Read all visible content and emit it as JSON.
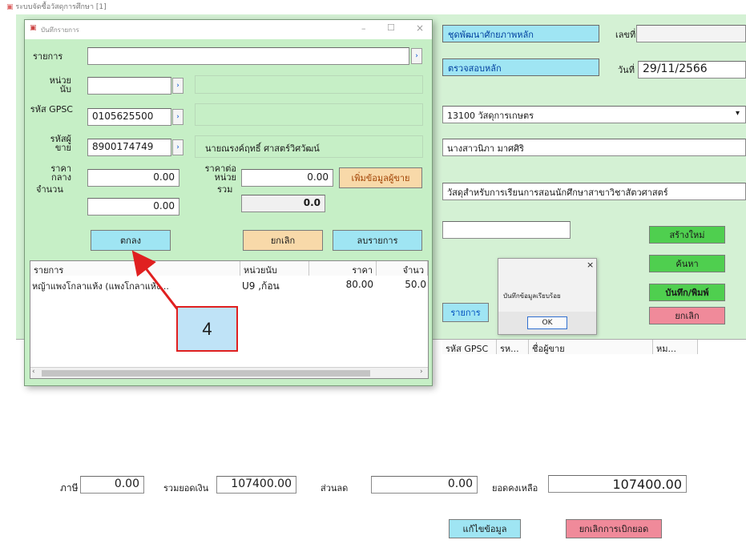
{
  "window": {
    "title": "ระบบจัดซื้อวัสดุการศึกษา [1]"
  },
  "main": {
    "top_box_1": "ชุดพัฒนาศักยภาพหลัก",
    "top_box_2": "ตรวจสอบหลัก",
    "doc_no_label": "เลขที่",
    "doc_no_value": "",
    "date_label": "วันที่",
    "date_value": "29/11/2566",
    "department_value": "13100 วัสดุการเกษตร",
    "person_value": "นางสาวนิภา มาศศิริ",
    "purpose_value": "วัสดุสำหรับการเรียนการสอนนักศึกษาสาขาวิชาสัตวศาสตร์",
    "remark_value": "",
    "btn_new": "สร้างใหม่",
    "btn_search": "ค้นหา",
    "btn_save_print": "บันทึก/พิมพ์",
    "btn_cancel": "ยกเลิก",
    "btn_items": "รายการ",
    "grid_headers": [
      "รหัส GPSC",
      "รห...",
      "ชื่อผู้ขาย",
      "หม..."
    ],
    "vat_label": "ภาษี",
    "vat_value": "0.00",
    "total_label": "รวมยอดเงิน",
    "total_value": "107400.00",
    "discount_label": "ส่วนลด",
    "discount_value": "0.00",
    "net_label": "ยอดคงเหลือ",
    "net_value": "107400.00",
    "btn_edit_data": "แก้ไขข้อมูล",
    "btn_cancel_doc": "ยกเลิกการเบิกยอด"
  },
  "msgbox": {
    "text": "บันทึกข้อมูลเรียบร้อย",
    "ok": "OK",
    "close": "×"
  },
  "dialog": {
    "title": "บันทึกรายการ",
    "min": "–",
    "max": "☐",
    "close": "×",
    "item_label": "รายการ",
    "item_value": "",
    "unit_label": "หน่วยนับ",
    "unit_value": "",
    "unit_name": "",
    "gpsc_label": "รหัส GPSC",
    "gpsc_value": "0105625500",
    "gpsc_name": "",
    "vendor_label": "รหัสผู้ขาย",
    "vendor_value": "8900174749",
    "vendor_name": "นายณรงค์ฤทธิ์ ศาสตร์วิศวัฒน์",
    "price_label": "ราคากลาง",
    "price_value": "0.00",
    "unit_price_label": "ราคาต่อหน่วย",
    "unit_price_value": "0.00",
    "add_vendor_button": "เพิ่มข้อมูลผู้ขาย",
    "qty_label": "จำนวน",
    "qty_value": "0.00",
    "sum_label": "รวม",
    "sum_value": "0.0",
    "ok_button": "ตกลง",
    "cancel_button": "ยกเลิก",
    "delete_button": "ลบรายการ",
    "list_headers": [
      "รายการ",
      "หน่วยนับ",
      "ราคา",
      "จำนว"
    ],
    "list_rows": [
      {
        "item": "หญ้าแพงโกลาแห้ง (แพงโกลาแห้ง...",
        "unit": "U9 ,ก้อน",
        "price": "80.00",
        "qty": "50.0"
      }
    ]
  },
  "callout": {
    "number": "4",
    "arrow_color": "#e02020"
  },
  "colors": {
    "dialog_bg": "#c6efc6",
    "main_panel_bg": "#d4f1d4",
    "cyan_box": "#9fe5f3",
    "green_button": "#4fcf4f",
    "pink_button": "#f08a9a",
    "callout_bg": "#bfe3f7"
  }
}
